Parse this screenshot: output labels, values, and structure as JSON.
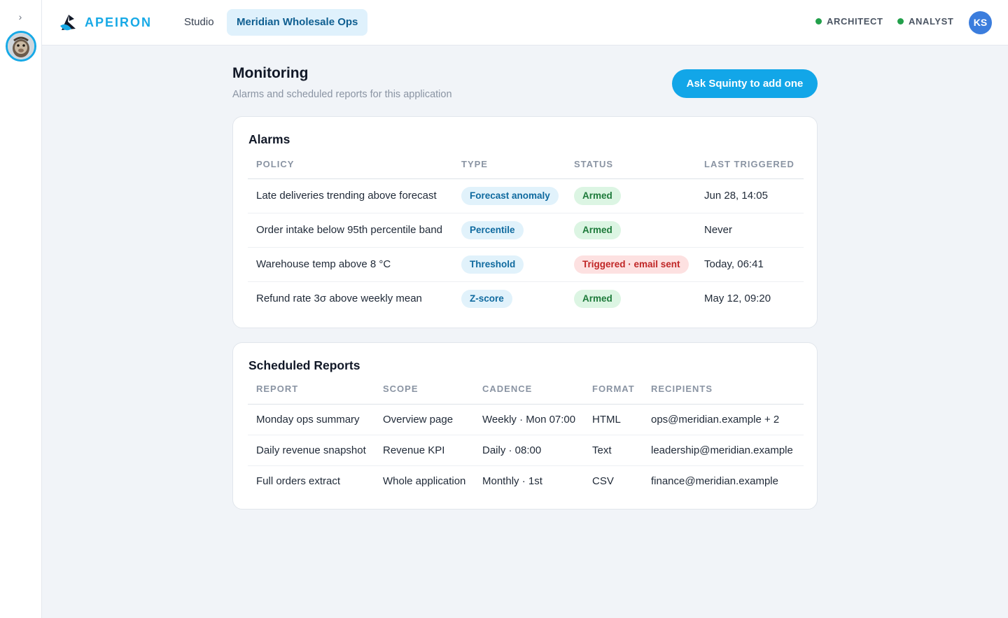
{
  "rail": {
    "toggle_glyph": "›",
    "avatar_icon": "monkey-avatar-icon"
  },
  "brand": {
    "name": "APEIRON",
    "color": "#17a9e6"
  },
  "nav": {
    "studio": "Studio",
    "active_app": "Meridian Wholesale Ops"
  },
  "roles": {
    "architect": "ARCHITECT",
    "analyst": "ANALYST",
    "status_color": "#22a04b"
  },
  "user": {
    "initials": "KS"
  },
  "page": {
    "title": "Monitoring",
    "subtitle": "Alarms and scheduled reports for this application",
    "primary_action": "Ask Squinty to add one"
  },
  "alarms": {
    "title": "Alarms",
    "columns": [
      "POLICY",
      "TYPE",
      "STATUS",
      "LAST TRIGGERED"
    ],
    "rows": [
      {
        "policy": "Late deliveries trending above forecast",
        "type": "Forecast anomaly",
        "status": "Armed",
        "status_kind": "armed",
        "last": "Jun 28, 14:05"
      },
      {
        "policy": "Order intake below 95th percentile band",
        "type": "Percentile",
        "status": "Armed",
        "status_kind": "armed",
        "last": "Never"
      },
      {
        "policy": "Warehouse temp above 8 °C",
        "type": "Threshold",
        "status": "Triggered · email sent",
        "status_kind": "triggered",
        "last": "Today, 06:41"
      },
      {
        "policy": "Refund rate 3σ above weekly mean",
        "type": "Z-score",
        "status": "Armed",
        "status_kind": "armed",
        "last": "May 12, 09:20"
      }
    ]
  },
  "reports": {
    "title": "Scheduled Reports",
    "columns": [
      "REPORT",
      "SCOPE",
      "CADENCE",
      "FORMAT",
      "RECIPIENTS"
    ],
    "rows": [
      {
        "report": "Monday ops summary",
        "scope": "Overview page",
        "cadence": "Weekly · Mon 07:00",
        "format": "HTML",
        "recipients": "ops@meridian.example + 2"
      },
      {
        "report": "Daily revenue snapshot",
        "scope": "Revenue KPI",
        "cadence": "Daily · 08:00",
        "format": "Text",
        "recipients": "leadership@meridian.example"
      },
      {
        "report": "Full orders extract",
        "scope": "Whole application",
        "cadence": "Monthly · 1st",
        "format": "CSV",
        "recipients": "finance@meridian.example"
      }
    ]
  }
}
